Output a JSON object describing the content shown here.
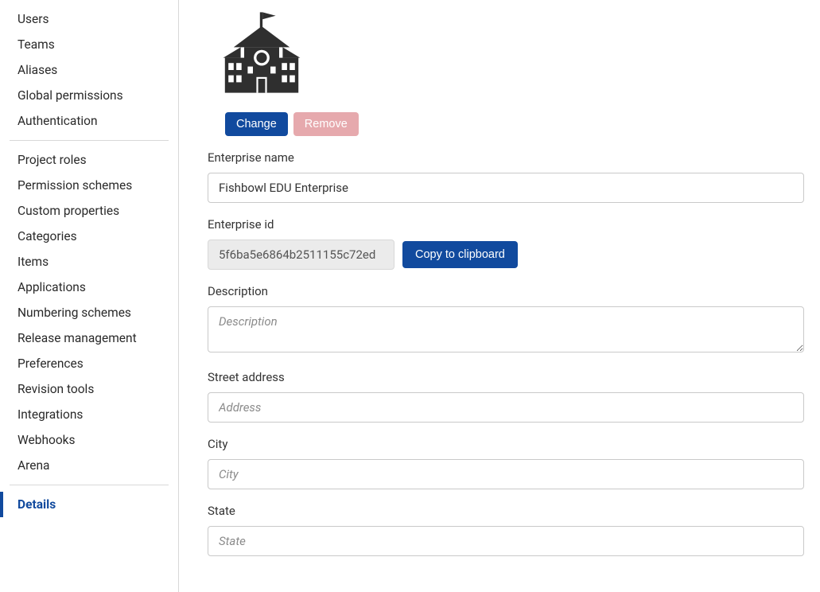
{
  "sidebar": {
    "group1": [
      {
        "label": "Users"
      },
      {
        "label": "Teams"
      },
      {
        "label": "Aliases"
      },
      {
        "label": "Global permissions"
      },
      {
        "label": "Authentication"
      }
    ],
    "group2": [
      {
        "label": "Project roles"
      },
      {
        "label": "Permission schemes"
      },
      {
        "label": "Custom properties"
      },
      {
        "label": "Categories"
      },
      {
        "label": "Items"
      },
      {
        "label": "Applications"
      },
      {
        "label": "Numbering schemes"
      },
      {
        "label": "Release management"
      },
      {
        "label": "Preferences"
      },
      {
        "label": "Revision tools"
      },
      {
        "label": "Integrations"
      },
      {
        "label": "Webhooks"
      },
      {
        "label": "Arena"
      }
    ],
    "group3": [
      {
        "label": "Details"
      }
    ]
  },
  "logo": {
    "change_label": "Change",
    "remove_label": "Remove"
  },
  "form": {
    "enterprise_name": {
      "label": "Enterprise name",
      "value": "Fishbowl EDU Enterprise"
    },
    "enterprise_id": {
      "label": "Enterprise id",
      "value": "5f6ba5e6864b2511155c72ed",
      "copy_label": "Copy to clipboard"
    },
    "description": {
      "label": "Description",
      "placeholder": "Description",
      "value": ""
    },
    "street": {
      "label": "Street address",
      "placeholder": "Address",
      "value": ""
    },
    "city": {
      "label": "City",
      "placeholder": "City",
      "value": ""
    },
    "state": {
      "label": "State",
      "placeholder": "State",
      "value": ""
    }
  }
}
